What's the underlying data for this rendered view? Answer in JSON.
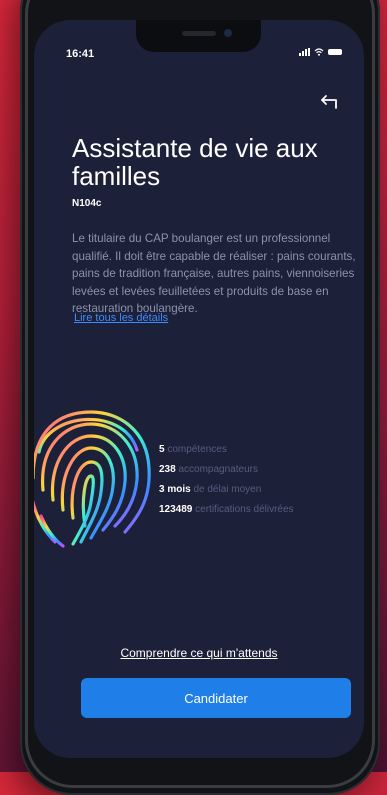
{
  "status_bar": {
    "time": "16:41"
  },
  "job": {
    "title": "Assistante de vie aux familles",
    "code": "N104c",
    "description": "Le titulaire du CAP boulanger est un professionnel qualifié. Il doit être capable de réaliser : pains courants, pains de tradition française, autres pains, viennoiseries levées et levées feuilletées et produits de base en restauration boulangère.",
    "details_link": "Lire tous les détails"
  },
  "stats": [
    {
      "value": "5",
      "label": "compétences"
    },
    {
      "value": "238",
      "label": "accompagnateurs"
    },
    {
      "value": "3 mois",
      "label": "de délai moyen"
    },
    {
      "value": "123489",
      "label": "certifications délivrées"
    }
  ],
  "actions": {
    "understand_link": "Comprendre ce qui m'attends",
    "apply_button": "Candidater"
  },
  "icons": {
    "back": "back-arrow-icon",
    "fingerprint": "fingerprint-icon",
    "signal": "signal-icon",
    "wifi": "wifi-icon",
    "battery": "battery-icon"
  },
  "colors": {
    "background": "#1c2039",
    "accent": "#1f7ee8",
    "link": "#3e8bff",
    "muted_text": "#8d93ab"
  }
}
